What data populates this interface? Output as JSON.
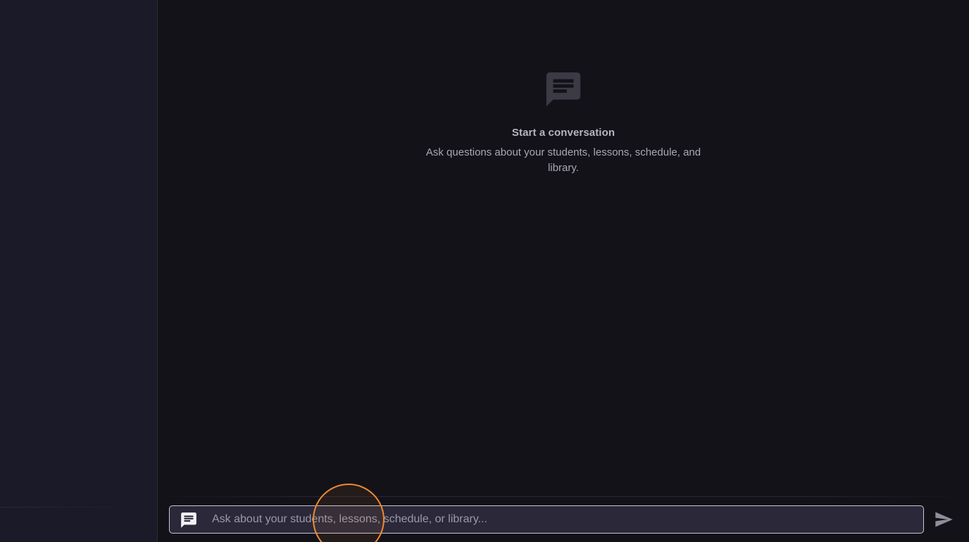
{
  "empty_state": {
    "icon": "chat-bubble-icon",
    "title": "Start a conversation",
    "subtitle": "Ask questions about your students, lessons, schedule, and library."
  },
  "composer": {
    "icon": "chat-bubble-icon",
    "placeholder": "Ask about your students, lessons, schedule, or library...",
    "value": "",
    "send_icon": "send-icon"
  },
  "colors": {
    "background": "#131219",
    "sidebar": "#1b1a29",
    "input_background": "#2a2839",
    "cursor_highlight": "#f08a2f"
  }
}
